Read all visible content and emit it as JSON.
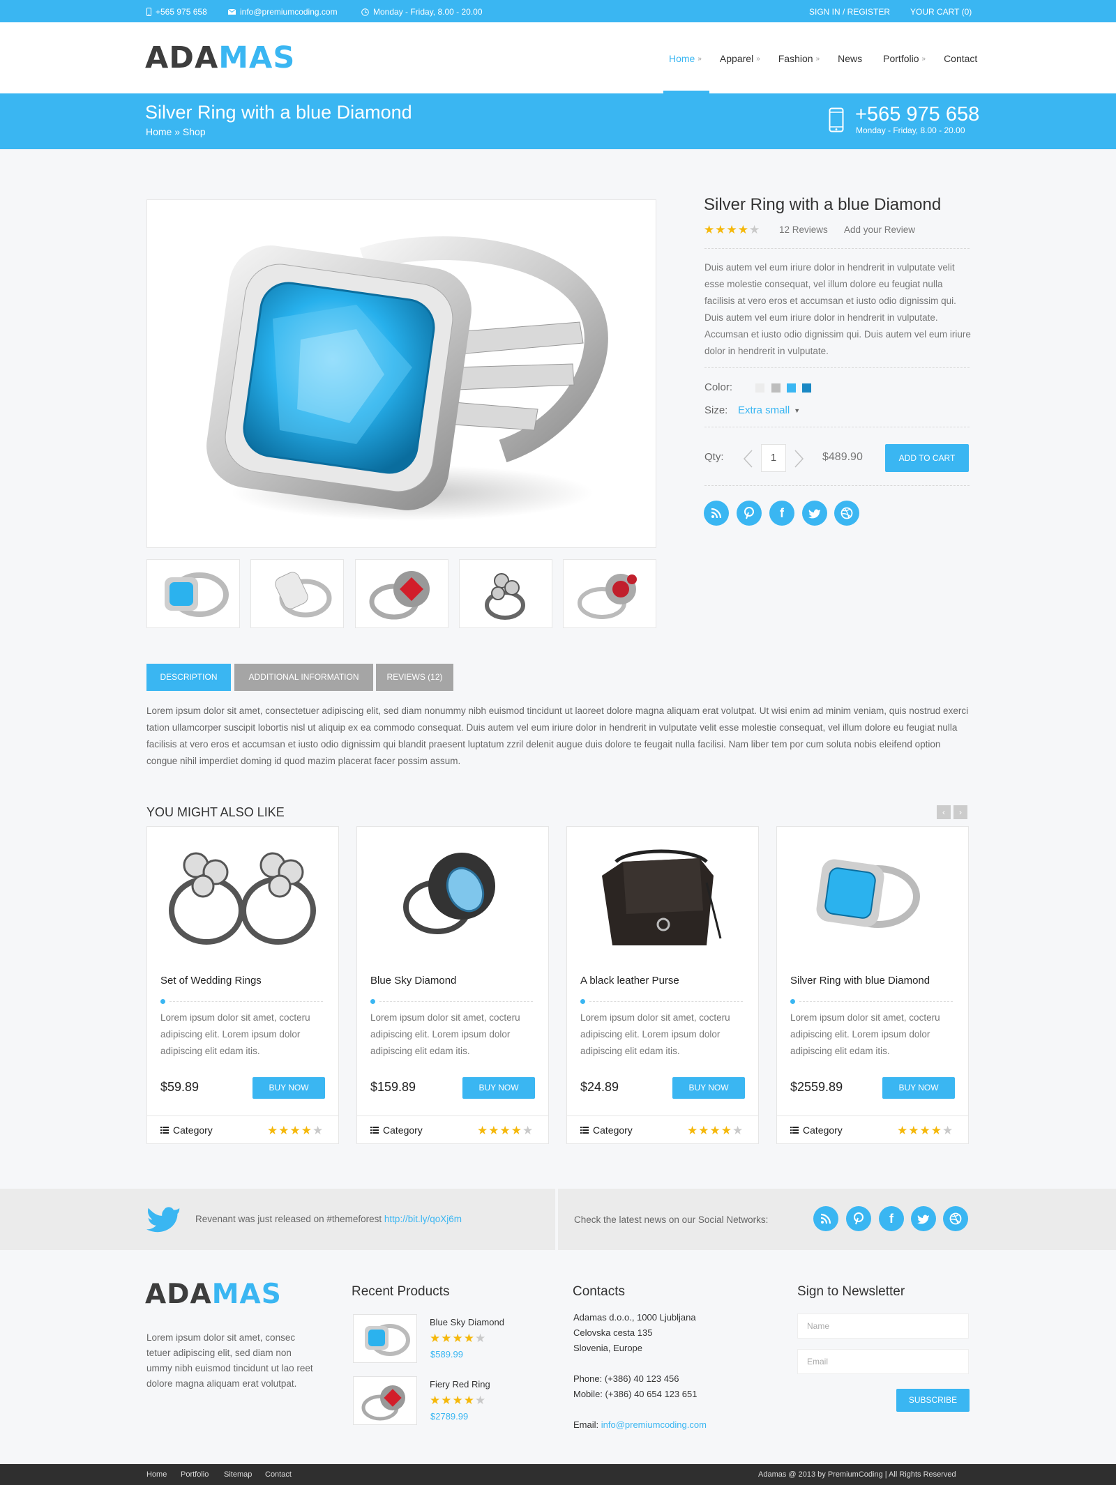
{
  "topbar": {
    "phone": "+565 975 658",
    "email": "info@premiumcoding.com",
    "hours": "Monday - Friday, 8.00 - 20.00",
    "signin": "SIGN IN / REGISTER",
    "cart": "YOUR CART (0)"
  },
  "brand": {
    "part1": "ADA",
    "part2": "MAS"
  },
  "nav": [
    {
      "label": "Home",
      "active": true,
      "submenu": true
    },
    {
      "label": "Apparel",
      "submenu": true
    },
    {
      "label": "Fashion",
      "submenu": true
    },
    {
      "label": "News",
      "submenu": false
    },
    {
      "label": "Portfolio",
      "submenu": true
    },
    {
      "label": "Contact",
      "submenu": false
    }
  ],
  "page_header": {
    "title": "Silver Ring with a blue Diamond",
    "breadcrumb": "Home  »  Shop",
    "phone": "+565 975 658",
    "hours": "Monday - Friday, 8.00 - 20.00"
  },
  "product": {
    "title": "Silver Ring with a blue Diamond",
    "rating": 4,
    "reviews": "12 Reviews",
    "add_review": "Add your Review",
    "description": "Duis autem vel eum iriure dolor in hendrerit in  vulputate velit esse molestie consequat, vel illum dolore eu feugiat nulla facilisis at vero eros et accumsan et iusto odio dignissim qui. Duis autem vel eum iriure dolor in hendrerit in  vulputate. Accumsan et iusto odio dignissim qui. Duis autem vel eum iriure dolor in hendrerit in  vulputate.",
    "color_label": "Color:",
    "colors": [
      "#ececec",
      "#bdbdbd",
      "#3ab6f2",
      "#1a88c4"
    ],
    "size_label": "Size:",
    "size_value": "Extra small",
    "qty_label": "Qty:",
    "qty": "1",
    "price": "$489.90",
    "add_to_cart": "ADD TO CART",
    "social": [
      "rss-icon",
      "pinterest-icon",
      "facebook-icon",
      "twitter-icon",
      "dribbble-icon"
    ]
  },
  "tabs": [
    {
      "label": "DESCRIPTION",
      "active": true
    },
    {
      "label": "ADDITIONAL INFORMATION",
      "active": false
    },
    {
      "label": "REVIEWS (12)",
      "active": false
    }
  ],
  "tab_content": "Lorem ipsum dolor sit amet, consectetuer adipiscing elit, sed diam nonummy nibh euismod tincidunt ut laoreet dolore magna aliquam erat volutpat. Ut wisi enim ad minim veniam, quis nostrud exerci tation ullamcorper suscipit lobortis nisl ut aliquip ex ea commodo consequat. Duis autem vel eum iriure dolor in hendrerit in vulputate velit esse molestie consequat, vel illum dolore eu feugiat nulla facilisis at vero eros et accumsan et iusto odio dignissim qui blandit praesent luptatum zzril delenit augue duis dolore te feugait nulla facilisi. Nam liber tem por cum soluta nobis eleifend option congue nihil imperdiet doming id quod mazim placerat facer possim assum.",
  "related": {
    "title": "YOU MIGHT ALSO LIKE",
    "items": [
      {
        "name": "Set of Wedding Rings",
        "desc": "Lorem ipsum dolor sit amet, cocteru adipiscing elit. Lorem ipsum dolor adipiscing elit edam itis.",
        "price": "$59.89",
        "buy": "BUY NOW",
        "category": "Category",
        "rating": 4
      },
      {
        "name": "Blue Sky Diamond",
        "desc": "Lorem ipsum dolor sit amet, cocteru adipiscing elit. Lorem ipsum dolor adipiscing elit edam itis.",
        "price": "$159.89",
        "buy": "BUY NOW",
        "category": "Category",
        "rating": 4
      },
      {
        "name": "A black leather Purse",
        "desc": "Lorem ipsum dolor sit amet, cocteru adipiscing elit. Lorem ipsum dolor adipiscing elit edam itis.",
        "price": "$24.89",
        "buy": "BUY NOW",
        "category": "Category",
        "rating": 4
      },
      {
        "name": "Silver Ring with blue Diamond",
        "desc": "Lorem ipsum dolor sit amet, cocteru adipiscing elit. Lorem ipsum dolor adipiscing elit edam itis.",
        "price": "$2559.89",
        "buy": "BUY NOW",
        "category": "Category",
        "rating": 4
      }
    ]
  },
  "twitter": {
    "text": "Revenant was just released on #themeforest",
    "link": "http://bit.ly/qoXj6m",
    "social_text": "Check the latest news on our Social Networks:"
  },
  "footer": {
    "about": "Lorem ipsum dolor sit amet, consec tetuer adipiscing elit, sed diam non ummy nibh euismod tincidunt ut lao reet dolore magna aliquam erat volutpat.",
    "recent_title": "Recent Products",
    "recent": [
      {
        "name": "Blue Sky Diamond",
        "price": "$589.99",
        "rating": 4
      },
      {
        "name": "Fiery Red Ring",
        "price": "$2789.99",
        "rating": 4
      }
    ],
    "contacts_title": "Contacts",
    "address1": "Adamas d.o.o., 1000 Ljubljana",
    "address2": "Celovska cesta 135",
    "address3": "Slovenia, Europe",
    "phone": "Phone: (+386) 40 123 456",
    "mobile": "Mobile: (+386) 40 654 123 651",
    "email_label": "Email: ",
    "email": "info@premiumcoding.com",
    "newsletter_title": "Sign to Newsletter",
    "name_placeholder": "Name",
    "email_placeholder": "Email",
    "subscribe": "SUBSCRIBE"
  },
  "bottom": {
    "links": [
      "Home",
      "Portfolio",
      "Sitemap",
      "Contact"
    ],
    "copyright": "Adamas @ 2013 by PremiumCoding | All Rights Reserved"
  }
}
